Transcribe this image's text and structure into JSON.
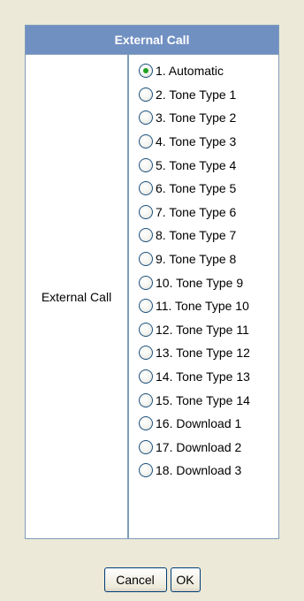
{
  "panel": {
    "title": "External Call",
    "row_label": "External Call",
    "selected_index": 0,
    "options": [
      "1. Automatic",
      "2. Tone Type 1",
      "3. Tone Type 2",
      "4. Tone Type 3",
      "5. Tone Type 4",
      "6. Tone Type 5",
      "7. Tone Type 6",
      "8. Tone Type 7",
      "9. Tone Type 8",
      "10. Tone Type 9",
      "11. Tone Type 10",
      "12. Tone Type 11",
      "13. Tone Type 12",
      "14. Tone Type 13",
      "15. Tone Type 14",
      "16. Download 1",
      "17. Download 2",
      "18. Download 3"
    ]
  },
  "buttons": {
    "cancel_label": "Cancel",
    "ok_label": "OK"
  },
  "colors": {
    "header_bg": "#7190c2",
    "border": "#7f9db9",
    "page_bg": "#ece9d8",
    "radio_selected": "#21a121"
  }
}
